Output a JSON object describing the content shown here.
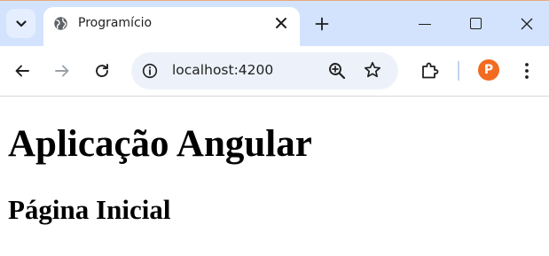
{
  "browser": {
    "tab_title": "Programício",
    "url": "localhost:4200",
    "avatar_letter": "P",
    "icons": {
      "tab_search": "chevron-down-icon",
      "favicon": "globe-icon",
      "tab_close": "close-icon",
      "new_tab": "plus-icon",
      "minimize": "minimize-icon",
      "maximize": "maximize-icon",
      "window_close": "close-icon",
      "back": "arrow-left-icon",
      "forward": "arrow-right-icon",
      "reload": "reload-icon",
      "site_info": "info-icon",
      "zoom": "zoom-in-icon",
      "bookmark": "star-icon",
      "extensions": "puzzle-icon",
      "menu": "kebab-menu-icon"
    },
    "colors": {
      "tabstrip_bg": "#d3e3fd",
      "omnibox_bg": "#edf2fa",
      "avatar_bg": "#f26b21",
      "forward_disabled": "#9aa0a6"
    }
  },
  "page": {
    "heading": "Aplicação Angular",
    "subheading": "Página Inicial"
  }
}
